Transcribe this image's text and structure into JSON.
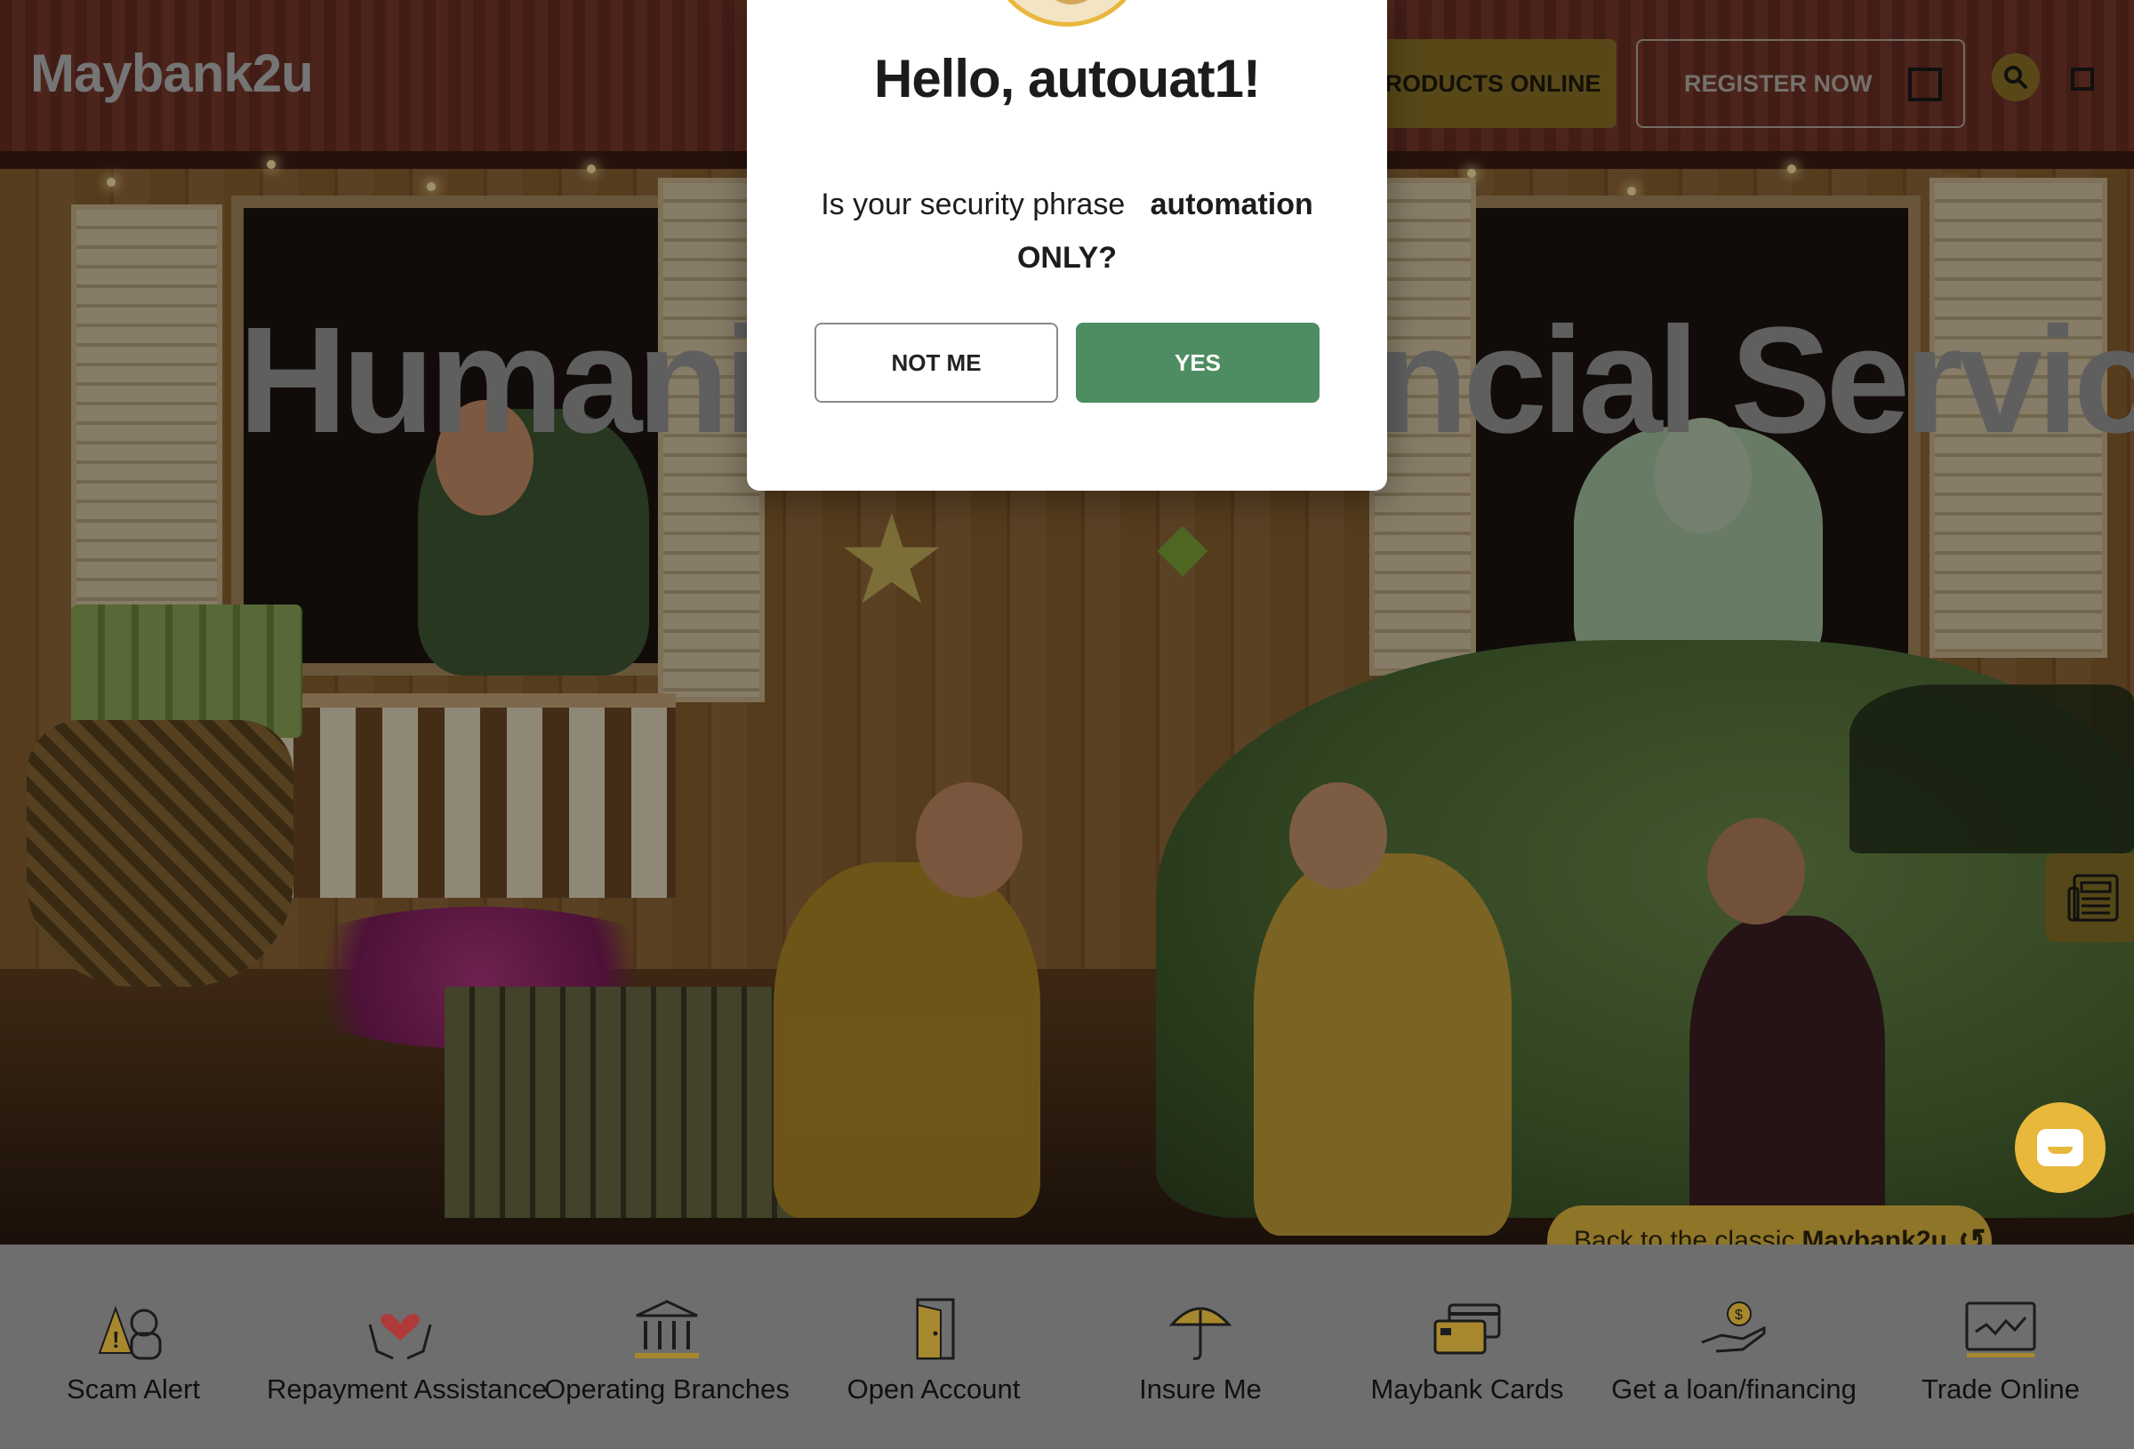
{
  "header": {
    "logo": "Maybank2u",
    "products_button": "RODUCTS ONLINE",
    "register_button": "REGISTER NOW"
  },
  "hero": {
    "title": "Humanising Financial Services"
  },
  "modal": {
    "greeting": "Hello, autouat1!",
    "question_prefix": "Is your security phrase",
    "security_phrase": "automation",
    "question_suffix": "ONLY?",
    "not_me_button": "NOT ME",
    "yes_button": "YES"
  },
  "back_classic": {
    "prefix": "Back to the classic",
    "brand": "Maybank2u"
  },
  "quick_links": [
    {
      "label": "Scam Alert",
      "icon": "scam-alert-icon"
    },
    {
      "label": "Repayment Assistance",
      "icon": "repayment-assistance-icon"
    },
    {
      "label": "Operating Branches",
      "icon": "bank-building-icon"
    },
    {
      "label": "Open Account",
      "icon": "door-icon"
    },
    {
      "label": "Insure Me",
      "icon": "umbrella-icon"
    },
    {
      "label": "Maybank Cards",
      "icon": "credit-card-icon"
    },
    {
      "label": "Get a loan/financing",
      "icon": "loan-hand-icon"
    },
    {
      "label": "Trade Online",
      "icon": "trade-chart-icon"
    }
  ],
  "colors": {
    "gold": "#e8b83c",
    "yes_green": "#4e8d61",
    "overlay": "rgba(0,0,0,0.38)"
  }
}
